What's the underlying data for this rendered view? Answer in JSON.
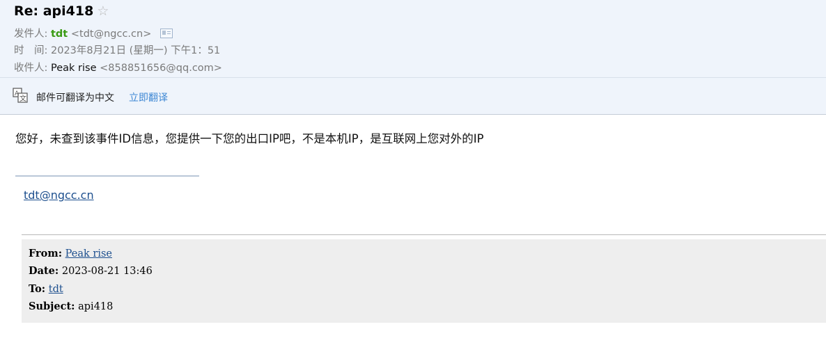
{
  "header": {
    "subject": "Re: api418",
    "star_icon": "star-outline-icon",
    "sender_label": "发件人:",
    "sender_name": "tdt",
    "sender_email": "<tdt@ngcc.cn>",
    "time_label": "时　间:",
    "time_value": "2023年8月21日 (星期一) 下午1：51",
    "recipient_label": "收件人:",
    "recipient_name": "Peak rise",
    "recipient_email": "<858851656@qq.com>",
    "colors": {
      "sender_name": "#3a9b14",
      "header_bg": "#eff4fb"
    }
  },
  "translate_bar": {
    "icon": "translate-icon",
    "text": "邮件可翻译为中文",
    "link": "立即翻译",
    "link_color": "#3d87d4"
  },
  "body": {
    "message": "您好，未查到该事件ID信息，您提供一下您的出口IP吧，不是本机IP，是互联网上您对外的IP",
    "signature_email": "tdt@ngcc.cn"
  },
  "quoted": {
    "from_label": "From:",
    "from_value": "Peak rise",
    "date_label": "Date:",
    "date_value": "2023-08-21 13:46",
    "to_label": "To:",
    "to_value": "tdt",
    "subject_label": "Subject:",
    "subject_value": "api418"
  }
}
